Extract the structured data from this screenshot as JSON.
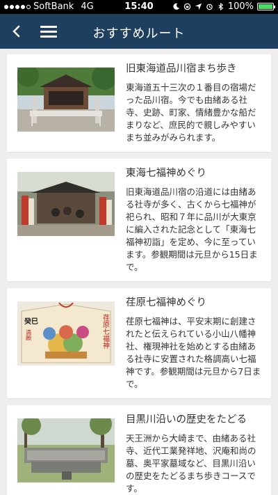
{
  "status": {
    "carrier": "SoftBank",
    "network": "4G",
    "time": "15:40",
    "battery": "100%",
    "battery_level": 1.0,
    "battery_color": "#4cd964"
  },
  "navbar": {
    "title": "おすすめルート",
    "back_icon": "chevron-left-icon",
    "menu_icon": "hamburger-menu-icon",
    "background": "#1f3f5f"
  },
  "routes": [
    {
      "title": "旧東海道品川宿まち歩き",
      "description": "東海道五十三次の１番目の宿場だった品川宿。今でも由緒ある社寺、史跡、町家、情緒豊かな船だまりなど、庶民的で親しみやすいまち並みがみられます。"
    },
    {
      "title": "東海七福神めぐり",
      "description": "旧東海道品川宿の沿道には由緒ある社寺が多く、古くから七福神が祀られ、昭和７年に品川が大東京に編入された記念として「東海七福神初詣」を定め、今に至っています。参観期間は元旦から15日まで。"
    },
    {
      "title": "荏原七福神めぐり",
      "description": "荏原七福神は、平安末期に創建されたと伝えられている小山八幡神社、権現神社を始めとする由緒ある社寺に安置された格調高い七福神です。参観期間は元旦から7日まで。",
      "ema_text_1": "荏原七福神",
      "ema_text_2": "癸巳",
      "ema_text_3": "満願"
    },
    {
      "title": "目黒川沿いの歴史をたどる",
      "description": "天王洲から大崎まで、由緒ある社寺、近代工業発祥地、沢庵和尚の墓、奥平家墓域など、目黒川沿いの歴史をたどるまち歩きコースです。"
    }
  ]
}
